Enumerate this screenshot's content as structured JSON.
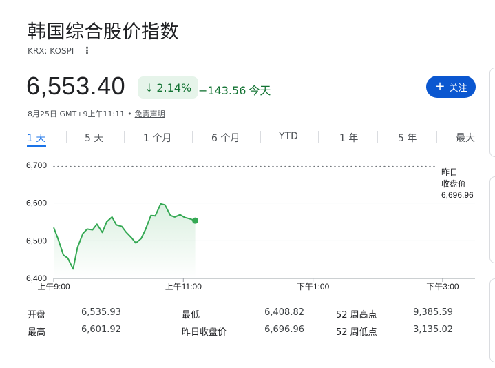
{
  "title": "韩国综合股价指数",
  "ticker": "KRX: KOSPI",
  "price": "6,553.40",
  "change_pct": "2.14%",
  "change_abs": "−143.56",
  "change_period": "今天",
  "follow_label": "关注",
  "timestamp": "8月25日 GMT+9上午11:11",
  "disclaimer": "免责声明",
  "tabs": [
    "1 天",
    "5 天",
    "1 个月",
    "6 个月",
    "YTD",
    "1 年",
    "5 年",
    "最大"
  ],
  "active_tab": 0,
  "chart_data": {
    "type": "line",
    "title": "",
    "y_ticks": [
      "6,700",
      "6,600",
      "6,500",
      "6,400"
    ],
    "x_ticks": [
      "上午9:00",
      "上午11:00",
      "下午1:00",
      "下午3:00"
    ],
    "ylim": [
      6400,
      6700
    ],
    "previous_close": {
      "label_line1": "昨日",
      "label_line2": "收盘价",
      "value": 6696.96,
      "value_text": "6,696.96"
    },
    "line_color": "#34a853",
    "series": [
      {
        "x": [
          "09:00",
          "09:04",
          "09:09",
          "09:13",
          "09:18",
          "09:22",
          "09:27",
          "09:31",
          "09:36",
          "09:40",
          "09:45",
          "09:49",
          "09:54",
          "09:58",
          "10:03",
          "10:07",
          "10:12",
          "10:16",
          "10:21",
          "10:25",
          "10:30",
          "10:34",
          "10:39",
          "10:43",
          "10:48",
          "10:52",
          "10:57",
          "11:01",
          "11:06",
          "11:11"
        ],
        "values": [
          6535,
          6505,
          6462,
          6454,
          6425,
          6482,
          6519,
          6531,
          6529,
          6544,
          6522,
          6550,
          6563,
          6542,
          6538,
          6523,
          6508,
          6494,
          6506,
          6530,
          6567,
          6566,
          6598,
          6595,
          6567,
          6563,
          6569,
          6562,
          6558,
          6553.4
        ]
      }
    ]
  },
  "stats": {
    "open_label": "开盘",
    "open": "6,535.93",
    "high_label": "最高",
    "high": "6,601.92",
    "low_label": "最低",
    "low": "6,408.82",
    "prev_close_label": "昨日收盘价",
    "prev_close": "6,696.96",
    "wk52_high_label": "52 周高点",
    "wk52_high": "9,385.59",
    "wk52_low_label": "52 周低点",
    "wk52_low": "3,135.02"
  }
}
